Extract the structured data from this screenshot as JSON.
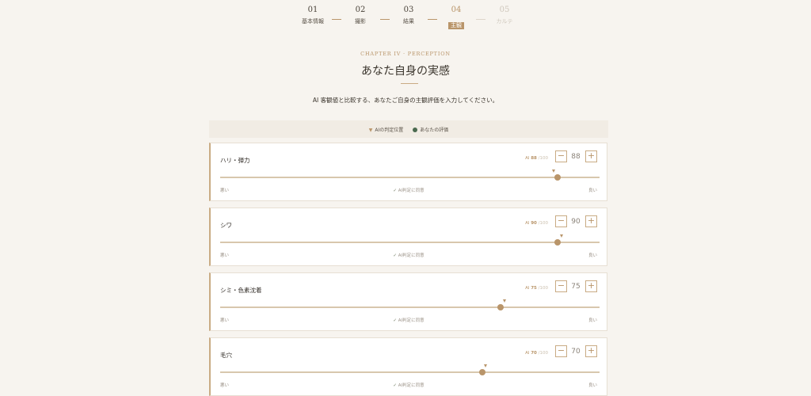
{
  "stepper": {
    "steps": [
      {
        "num": "01",
        "label": "基本情報",
        "state": "done"
      },
      {
        "num": "02",
        "label": "撮影",
        "state": "done"
      },
      {
        "num": "03",
        "label": "結果",
        "state": "done"
      },
      {
        "num": "04",
        "label": "主観",
        "state": "active"
      },
      {
        "num": "05",
        "label": "カルテ",
        "state": "future"
      }
    ]
  },
  "header": {
    "chapter": "CHAPTER IV · PERCEPTION",
    "title": "あなた自身の実感",
    "subtitle": "AI 客観値と比較する、あなたご自身の主観評価を入力してください。"
  },
  "legend": {
    "ai_label": "AIの判定位置",
    "user_label": "あなたの評価"
  },
  "common": {
    "ai_prefix": "AI",
    "max_suffix": "/100",
    "minus": "−",
    "plus": "+",
    "left_label": "悪い",
    "right_label": "良い",
    "agree_check": "✓",
    "agree_text": "AI判定に同意"
  },
  "metrics": [
    {
      "label": "ハリ・弾力",
      "ai_value": "88",
      "user_value": "88",
      "ai": 88,
      "user": 89
    },
    {
      "label": "シワ",
      "ai_value": "90",
      "user_value": "90",
      "ai": 90,
      "user": 89
    },
    {
      "label": "シミ・色素沈着",
      "ai_value": "75",
      "user_value": "75",
      "ai": 75,
      "user": 74
    },
    {
      "label": "毛穴",
      "ai_value": "70",
      "user_value": "70",
      "ai": 70,
      "user": 69
    }
  ],
  "colors": {
    "accent": "#b9956a",
    "user_dot": "#4a6a4f",
    "background": "#f7f4ef"
  }
}
